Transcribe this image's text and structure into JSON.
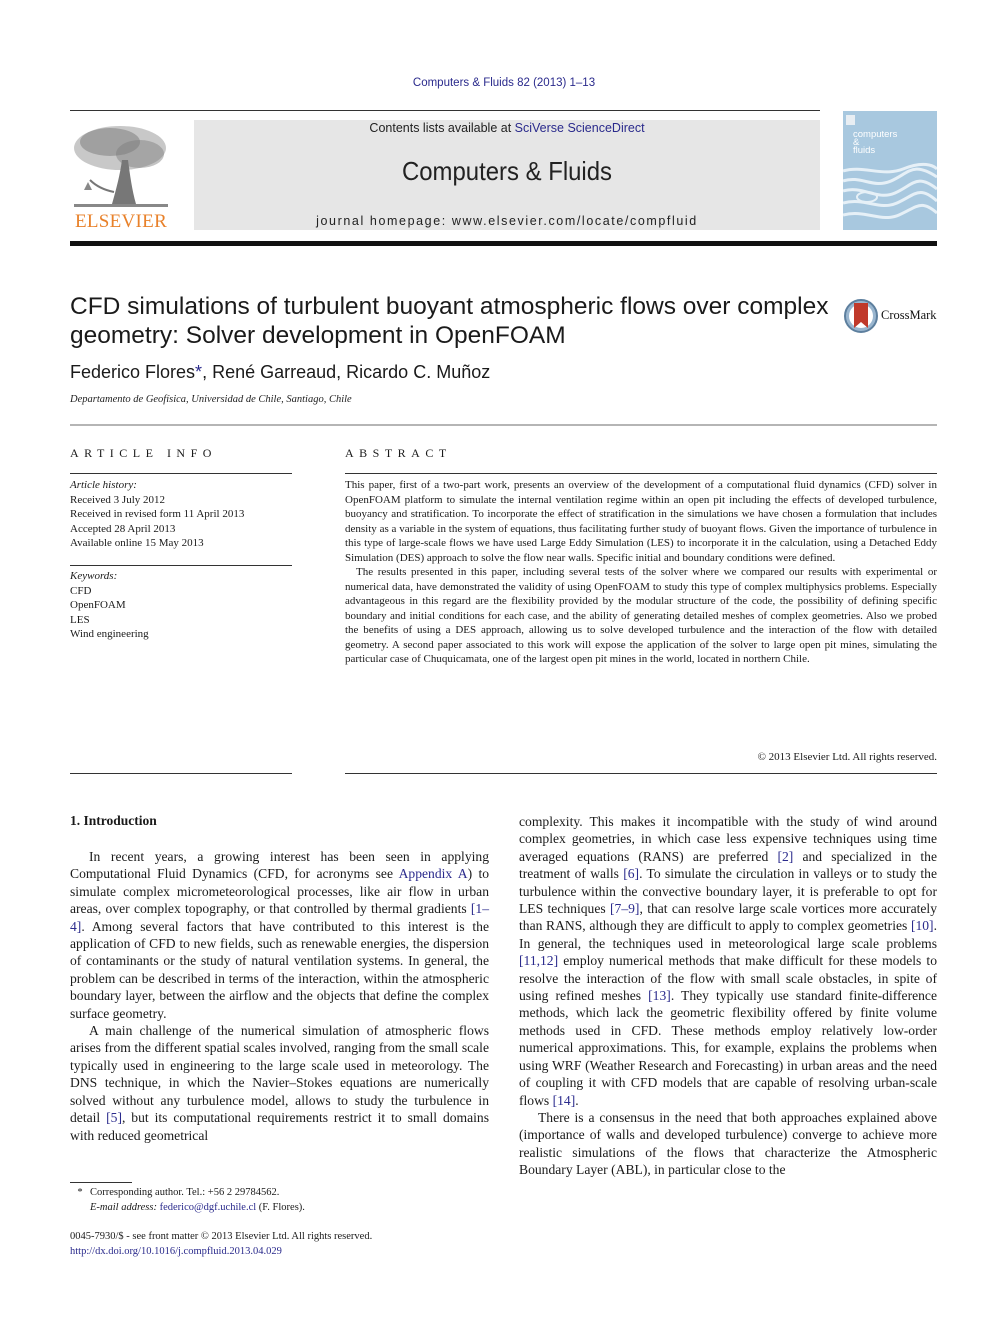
{
  "header": {
    "journal_ref": "Computers & Fluids 82 (2013) 1–13",
    "contents_prefix": "Contents lists available at ",
    "contents_link": "SciVerse ScienceDirect",
    "journal_title": "Computers & Fluids",
    "homepage": "journal homepage: www.elsevier.com/locate/compfluid",
    "publisher_logo_text": "ELSEVIER",
    "cover": {
      "line1": "computers",
      "line2": "&",
      "line3": "fluids"
    },
    "colors": {
      "elsevier_orange": "#e8812a",
      "masthead_gray": "#e6e6e6",
      "link_blue": "#2a2a8c",
      "cover_blue": "#a8c8df"
    }
  },
  "article": {
    "title": "CFD simulations of turbulent buoyant atmospheric flows over complex geometry: Solver development in OpenFOAM",
    "crossmark_label": "CrossMark",
    "authors": [
      {
        "name": "Federico Flores",
        "mark": "*"
      },
      {
        "name": "René Garreaud"
      },
      {
        "name": "Ricardo C. Muñoz"
      }
    ],
    "author_sep": ", ",
    "affiliation": "Departamento de Geofísica, Universidad de Chile, Santiago, Chile"
  },
  "article_info": {
    "heading": "ARTICLE INFO",
    "history_label": "Article history:",
    "history": [
      "Received 3 July 2012",
      "Received in revised form 11 April 2013",
      "Accepted 28 April 2013",
      "Available online 15 May 2013"
    ],
    "keywords_label": "Keywords:",
    "keywords": [
      "CFD",
      "OpenFOAM",
      "LES",
      "Wind engineering"
    ]
  },
  "abstract": {
    "heading": "ABSTRACT",
    "paragraphs": [
      "This paper, first of a two-part work, presents an overview of the development of a computational fluid dynamics (CFD) solver in OpenFOAM platform to simulate the internal ventilation regime within an open pit including the effects of developed turbulence, buoyancy and stratification. To incorporate the effect of stratification in the simulations we have chosen a formulation that includes density as a variable in the system of equations, thus facilitating further study of buoyant flows. Given the importance of turbulence in this type of large-scale flows we have used Large Eddy Simulation (LES) to incorporate it in the calculation, using a Detached Eddy Simulation (DES) approach to solve the flow near walls. Specific initial and boundary conditions were defined.",
      "The results presented in this paper, including several tests of the solver where we compared our results with experimental or numerical data, have demonstrated the validity of using OpenFOAM to study this type of complex multiphysics problems. Especially advantageous in this regard are the flexibility provided by the modular structure of the code, the possibility of defining specific boundary and initial conditions for each case, and the ability of generating detailed meshes of complex geometries. Also we probed the benefits of using a DES approach, allowing us to solve developed turbulence and the interaction of the flow with detailed geometry. A second paper associated to this work will expose the application of the solver to large open pit mines, simulating the particular case of Chuquicamata, one of the largest open pit mines in the world, located in northern Chile."
    ],
    "copyright": "© 2013 Elsevier Ltd. All rights reserved."
  },
  "introduction": {
    "heading": "1. Introduction",
    "col1": [
      [
        {
          "t": "In recent years, a growing interest has been seen in applying Computational Fluid Dynamics (CFD, for acronyms see "
        },
        {
          "t": "Appendix A",
          "link": true
        },
        {
          "t": ") to simulate complex micrometeorological processes, like air flow in urban areas, over complex topography, or that controlled by thermal gradients "
        },
        {
          "t": "[1–4]",
          "link": true
        },
        {
          "t": ". Among several factors that have con­tributed to this interest is the application of CFD to new fields, such as renewable energies, the dispersion of contaminants or the study of natural ventilation systems. In general, the problem can be de­scribed in terms of the interaction, within the atmospheric bound­ary layer, between the airflow and the objects that define the complex surface geometry."
        }
      ],
      [
        {
          "t": "A main challenge of the numerical simulation of atmospheric flows arises from the different spatial scales involved, ranging from the small scale typically used in engineering to the large scale used in meteorology. The DNS technique, in which the Navier–Stokes equations are numerically solved without any turbulence model, allows to study the turbulence in detail "
        },
        {
          "t": "[5]",
          "link": true
        },
        {
          "t": ", but its computational requirements restrict it to small domains with reduced geometrical"
        }
      ]
    ],
    "col2": [
      [
        {
          "t": "complexity. This makes it incompatible with the study of wind around complex geometries, in which case less expensive techniques using time averaged equations (RANS) are preferred "
        },
        {
          "t": "[2]",
          "link": true
        },
        {
          "t": " and specialized in the treatment of walls "
        },
        {
          "t": "[6]",
          "link": true
        },
        {
          "t": ". To simulate the cir­culation in valleys or to study the turbulence within the convective boundary layer, it is preferable to opt for LES techniques "
        },
        {
          "t": "[7–9]",
          "link": true
        },
        {
          "t": ", that can resolve large scale vortices more accurately than RANS, although they are difficult to apply to complex geometries "
        },
        {
          "t": "[10]",
          "link": true
        },
        {
          "t": ". In general, the techniques used in meteorological large scale problems "
        },
        {
          "t": "[11,12]",
          "link": true
        },
        {
          "t": " employ numerical methods that make difficult for these models to resolve the interaction of the flow with small scale obstacles, in spite of using refined meshes "
        },
        {
          "t": "[13]",
          "link": true
        },
        {
          "t": ". They typically use standard finite-difference methods, which lack the geometric flexi­bility offered by finite volume methods used in CFD. These methods employ relatively low-order numerical approximations. This, for example, explains the problems when using WRF (Weather Re­search and Forecasting) in urban areas and the need of coupling it with CFD models that are capable of resolving urban-scale flows "
        },
        {
          "t": "[14]",
          "link": true
        },
        {
          "t": "."
        }
      ],
      [
        {
          "t": "There is a consensus in the need that both approaches explained above (importance of walls and developed turbulence) converge to achieve more realistic simulations of the flows that characterize the Atmospheric Boundary Layer (ABL), in particular close to the"
        }
      ]
    ]
  },
  "footnote": {
    "mark": "*",
    "corresponding": "Corresponding author. Tel.: +56 2 29784562.",
    "email_label": "E-mail address:",
    "email": "federico@dgf.uchile.cl",
    "email_suffix": " (F. Flores)."
  },
  "front_matter": {
    "issn_line": "0045-7930/$ - see front matter © 2013 Elsevier Ltd. All rights reserved.",
    "doi": "http://dx.doi.org/10.1016/j.compfluid.2013.04.029"
  }
}
